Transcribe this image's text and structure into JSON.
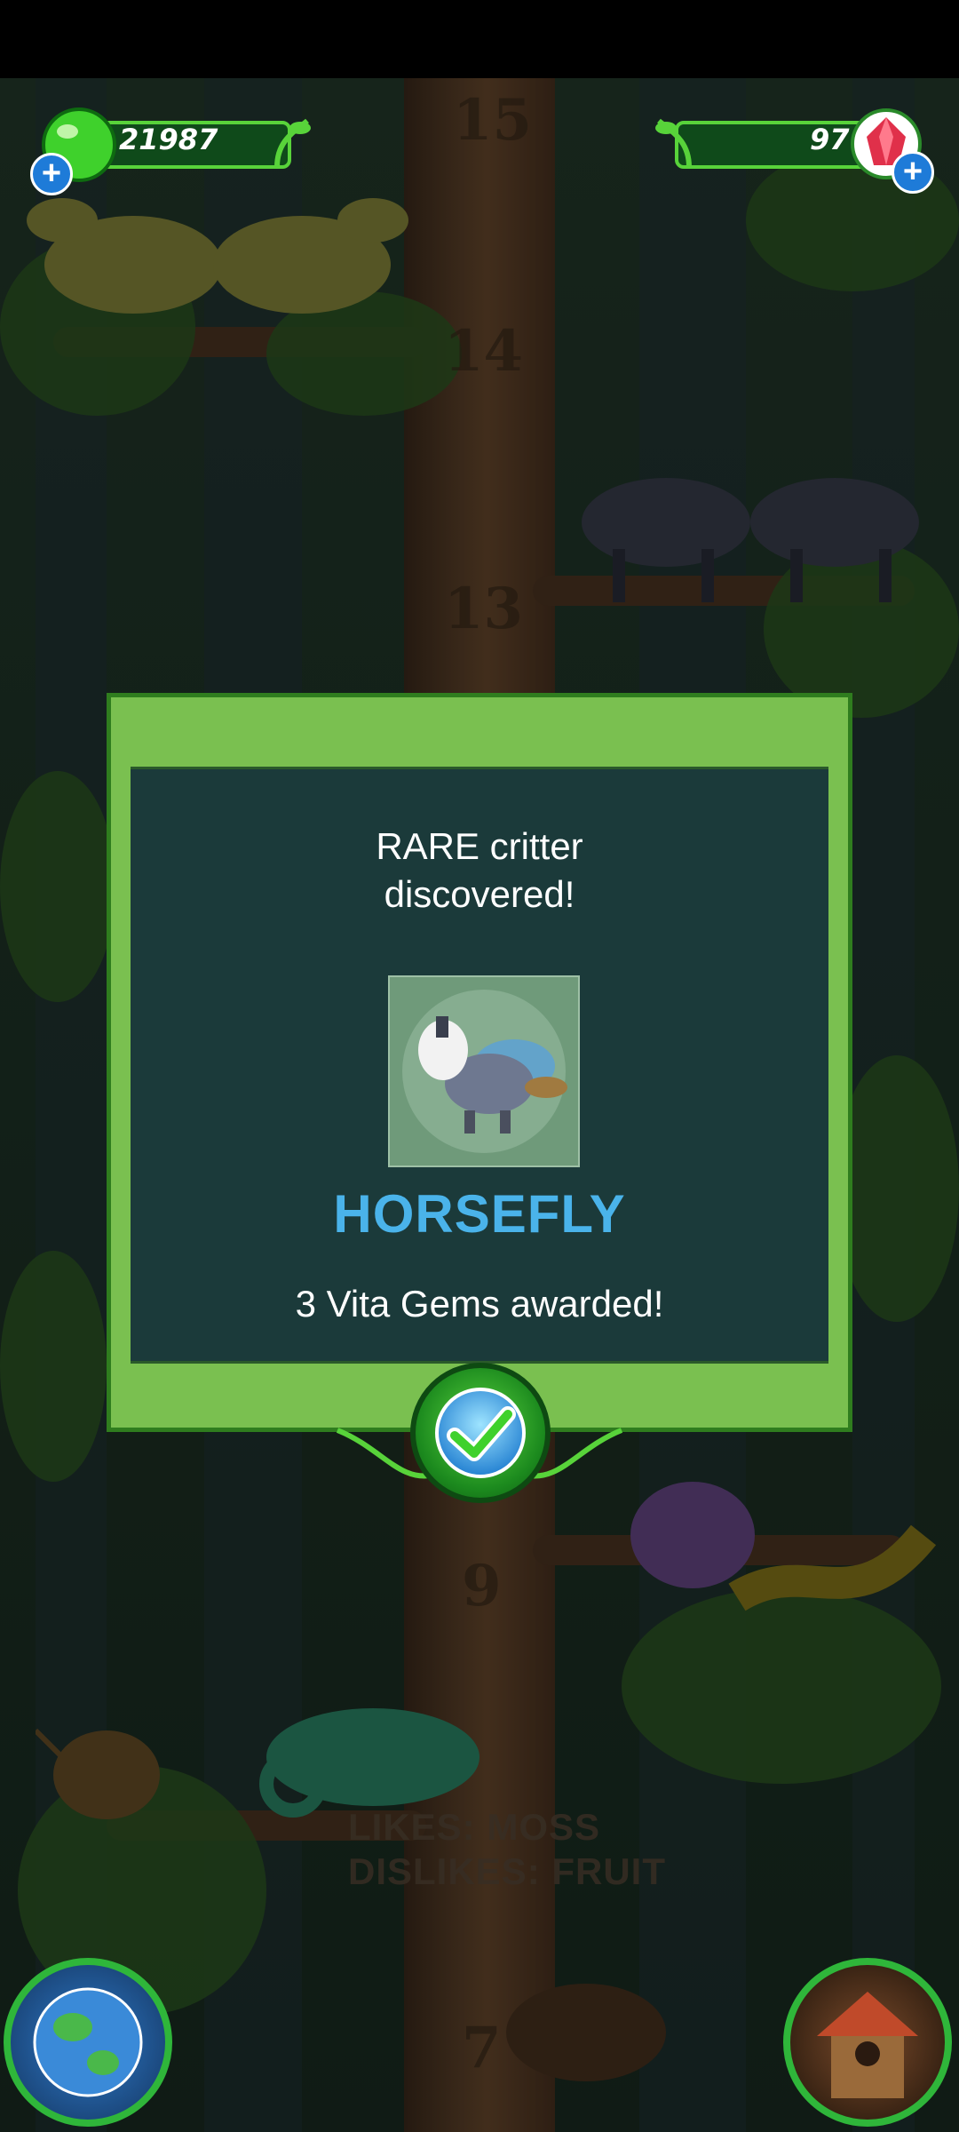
{
  "hud": {
    "vita_count": "21987",
    "gem_count": "97"
  },
  "scene": {
    "levels": [
      "15",
      "14",
      "13",
      "9",
      "7"
    ],
    "likes_line": "LIKES: MOSS",
    "dislikes_line": "DISLIKES: FRUIT"
  },
  "dialog": {
    "title_line1": "RARE critter",
    "title_line2": "discovered!",
    "critter_name": "HORSEFLY",
    "award_text": "3 Vita Gems awarded!"
  },
  "colors": {
    "accent_green": "#7ac050",
    "critter_name_blue": "#4ab3ea",
    "panel_dark": "#1b3a3a"
  },
  "icons": [
    "vita-drop-icon",
    "gem-icon",
    "plus-icon",
    "checkmark-icon",
    "globe-icon",
    "house-icon"
  ]
}
